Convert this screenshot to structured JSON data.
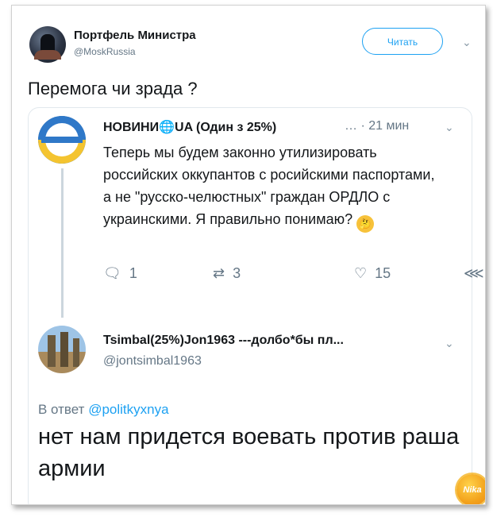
{
  "tweet": {
    "author_name": "Портфель Министра",
    "author_handle": "@MoskRussia",
    "follow_label": "Читать",
    "text": "Перемога чи зрада ?"
  },
  "quoted": {
    "author_name": "НОВИНИ",
    "author_suffix": "UA (Один з 25%)",
    "meta": "… · 21 мин",
    "text": "Теперь мы будем законно утилизировать российских оккупантов с росийскими паспортами, а не \"русско-челюстных\" граждан ОРДЛО с украинскими. Я правильно понимаю?",
    "emoji": "thinking-face",
    "replies": "1",
    "retweets": "3",
    "likes": "15"
  },
  "reply": {
    "author_name": "Tsimbal(25%)Jon1963 ---долбо*бы пл...",
    "author_handle": "@jontsimbal1963",
    "reply_prefix": "В ответ",
    "reply_mention": "@politkyxnya",
    "text": "нет нам придется воевать против раша армии"
  },
  "watermark": "Nika"
}
